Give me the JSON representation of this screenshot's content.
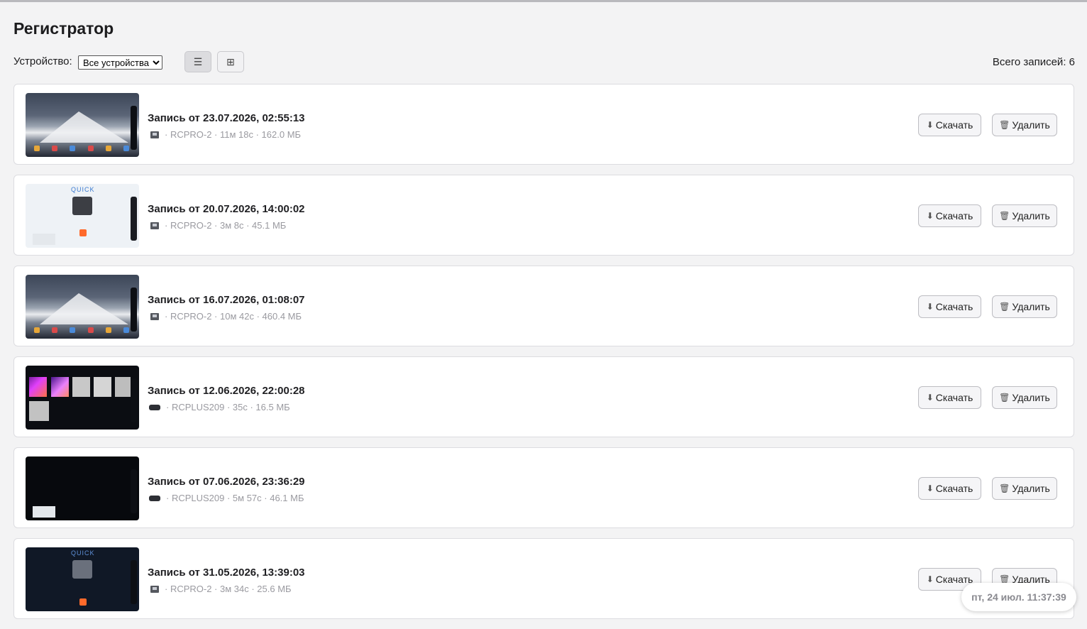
{
  "page": {
    "title": "Регистратор"
  },
  "toolbar": {
    "device_label": "Устройство:",
    "device_select": "Все устройства",
    "total_label": "Всего записей: 6",
    "list_view_icon": "list-icon",
    "grid_view_icon": "grid-icon"
  },
  "actions": {
    "download": "Скачать",
    "delete": "Удалить",
    "download_icon": "download-icon",
    "delete_icon": "trash-icon"
  },
  "records": [
    {
      "title": "Запись от 23.07.2026, 02:55:13",
      "meta": "· RCPRO-2 · 11м 18с · 162.0 МБ",
      "device_icon": "tablet-icon",
      "thumb": "mountain"
    },
    {
      "title": "Запись от 20.07.2026, 14:00:02",
      "meta": "· RCPRO-2 · 3м 8с · 45.1 МБ",
      "device_icon": "tablet-icon",
      "thumb": "light",
      "thumb_brand": "QUICK"
    },
    {
      "title": "Запись от 16.07.2026, 01:08:07",
      "meta": "· RCPRO-2 · 10м 42с · 460.4 МБ",
      "device_icon": "tablet-icon",
      "thumb": "mountain"
    },
    {
      "title": "Запись от 12.06.2026, 22:00:28",
      "meta": "· RCPLUS209 · 35с · 16.5 МБ",
      "device_icon": "handheld-icon",
      "thumb": "thermal"
    },
    {
      "title": "Запись от 07.06.2026, 23:36:29",
      "meta": "· RCPLUS209 · 5м 57с · 46.1 МБ",
      "device_icon": "handheld-icon",
      "thumb": "dark"
    },
    {
      "title": "Запись от 31.05.2026, 13:39:03",
      "meta": "· RCPRO-2 · 3м 34с · 25.6 МБ",
      "device_icon": "tablet-icon",
      "thumb": "navy",
      "thumb_brand": "QUICK"
    }
  ],
  "clock": {
    "text": "пт, 24 июл. 11:37:39"
  }
}
